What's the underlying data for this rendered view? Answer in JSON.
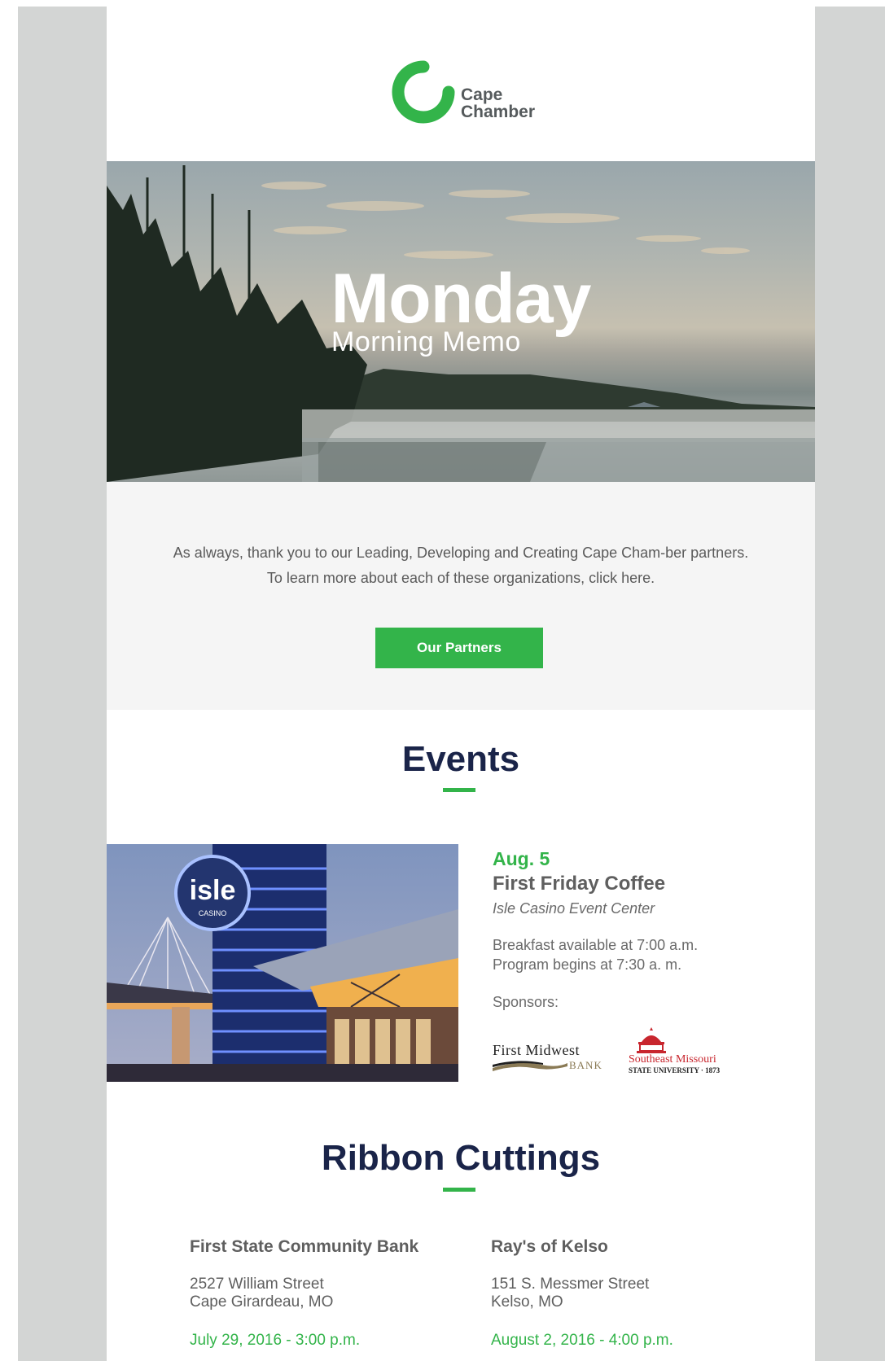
{
  "brand": {
    "logo_line1": "Cape",
    "logo_line2": "Chamber",
    "accent": "#33b44a",
    "navy": "#1a2449"
  },
  "hero": {
    "title": "Monday",
    "subtitle": "Morning Memo"
  },
  "intro": {
    "text": "As always, thank you to our Leading, Developing and Creating Cape Cham-ber partners. To learn more about each of these organizations, click here.",
    "button_label": "Our Partners"
  },
  "events": {
    "heading": "Events",
    "item": {
      "date": "Aug. 5",
      "title": "First Friday Coffee",
      "venue": "Isle Casino Event Center",
      "detail_1": "Breakfast available at 7:00 a.m.",
      "detail_2": "Program begins at 7:30 a. m.",
      "sponsors_label": "Sponsors:",
      "sponsor_1": {
        "name": "First Midwest",
        "sub": "BANK"
      },
      "sponsor_2": {
        "name": "Southeast Missouri",
        "sub": "STATE UNIVERSITY · 1873"
      },
      "image_sign": "isle",
      "image_sign_sub": "CASINO"
    }
  },
  "ribbon": {
    "heading": "Ribbon Cuttings",
    "items": [
      {
        "name": "First State Community Bank",
        "address_1": "2527 William Street",
        "address_2": "Cape Girardeau, MO",
        "date": "July 29, 2016 - 3:00 p.m."
      },
      {
        "name": "Ray's of Kelso",
        "address_1": "151 S. Messmer Street",
        "address_2": "Kelso, MO",
        "date": "August 2, 2016 - 4:00 p.m."
      }
    ]
  }
}
